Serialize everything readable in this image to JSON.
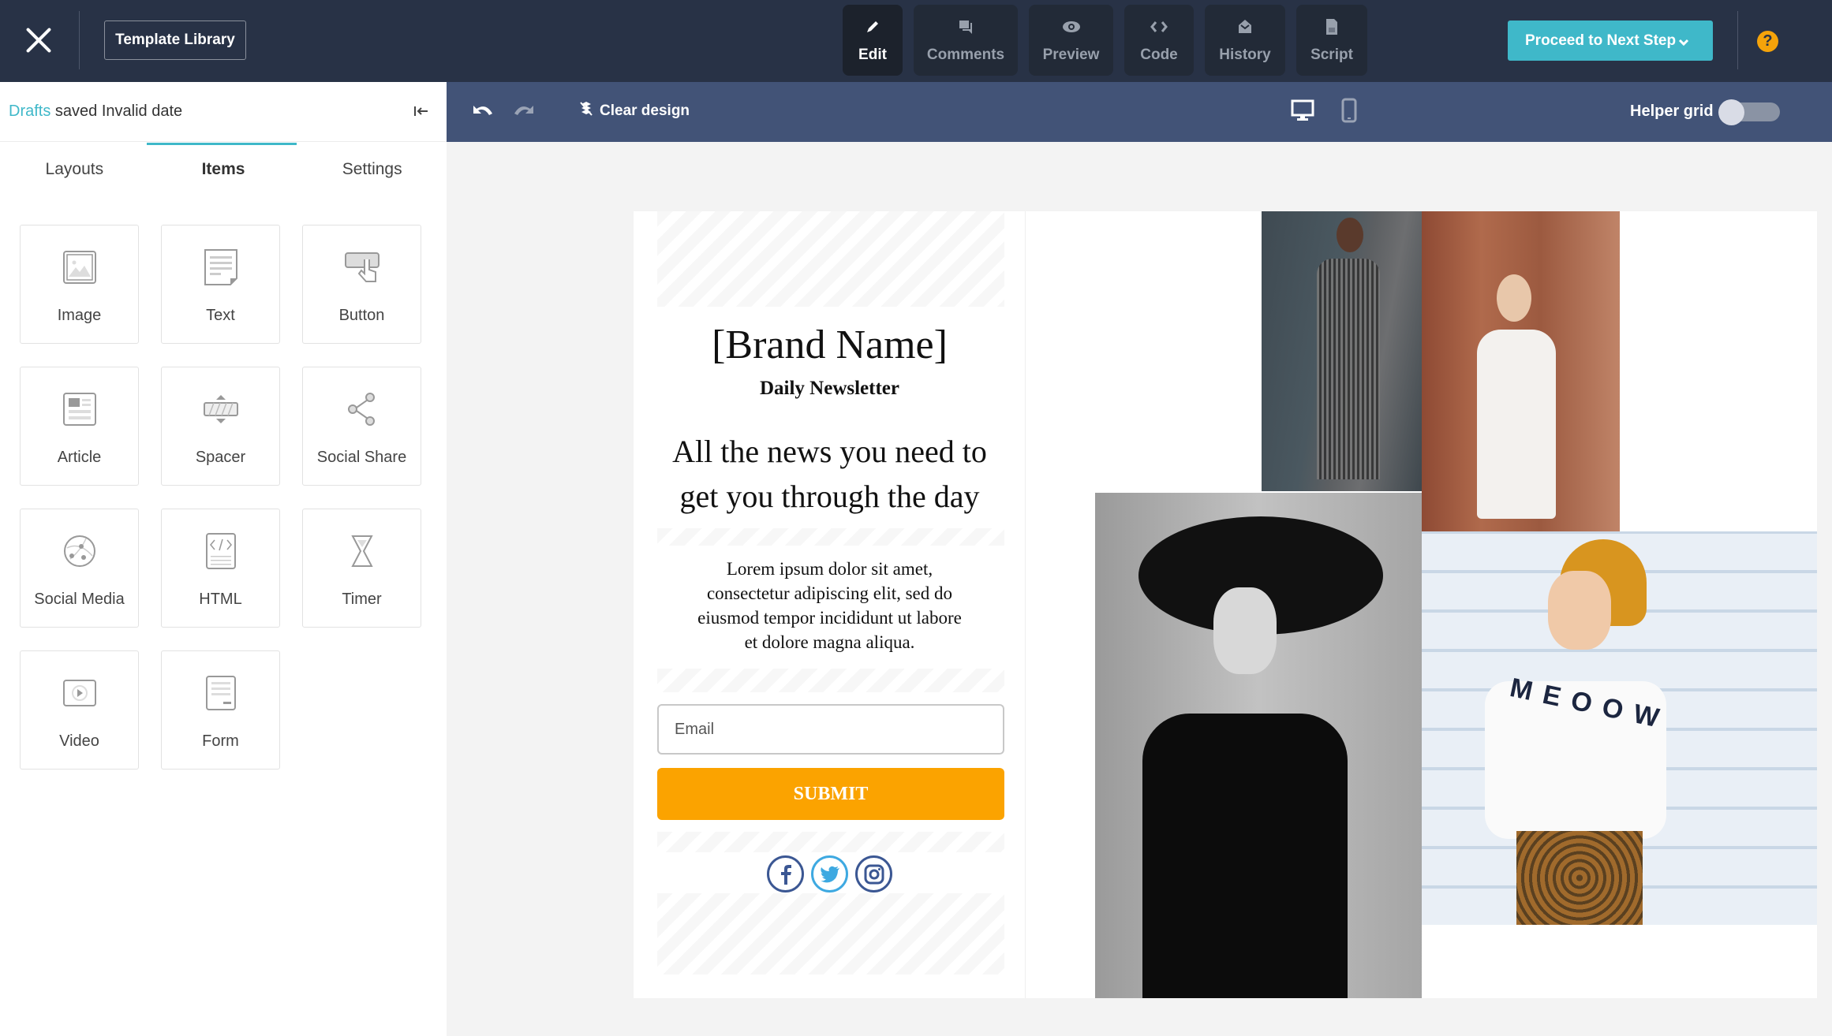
{
  "topbar": {
    "template_library": "Template Library",
    "tabs": [
      {
        "label": "Edit",
        "icon": "pencil-icon",
        "active": true
      },
      {
        "label": "Comments",
        "icon": "comments-icon",
        "active": false
      },
      {
        "label": "Preview",
        "icon": "eye-icon",
        "active": false
      },
      {
        "label": "Code",
        "icon": "code-icon",
        "active": false
      },
      {
        "label": "History",
        "icon": "history-icon",
        "active": false
      },
      {
        "label": "Script",
        "icon": "script-icon",
        "active": false
      }
    ],
    "proceed": "Proceed to Next Step",
    "help": "?"
  },
  "sidebar": {
    "drafts": "Drafts",
    "saved_status": " saved Invalid date",
    "tabs": [
      "Layouts",
      "Items",
      "Settings"
    ],
    "active_tab": "Items",
    "items": [
      "Image",
      "Text",
      "Button",
      "Article",
      "Spacer",
      "Social Share",
      "Social Media",
      "HTML",
      "Timer",
      "Video",
      "Form"
    ]
  },
  "subbar": {
    "clear_design": "Clear design",
    "helper_grid": "Helper grid",
    "helper_grid_on": false,
    "device": "desktop"
  },
  "template": {
    "brand": "[Brand Name]",
    "subtitle": "Daily Newsletter",
    "headline_1": "All the news you need to",
    "headline_2": "get you through the day",
    "body": [
      "Lorem ipsum dolor sit amet,",
      "consectetur adipiscing elit, sed do",
      "eiusmod tempor incididunt ut labore",
      "et dolore magna aliqua."
    ],
    "email_placeholder": "Email",
    "submit": "SUBMIT",
    "socials": [
      "facebook",
      "twitter",
      "instagram"
    ],
    "photo_text": "MEOOW"
  },
  "colors": {
    "accent": "#3fb8c9",
    "topbar": "#283246",
    "subbar": "#425377",
    "submit": "#fba300",
    "help": "#f5a30a"
  }
}
